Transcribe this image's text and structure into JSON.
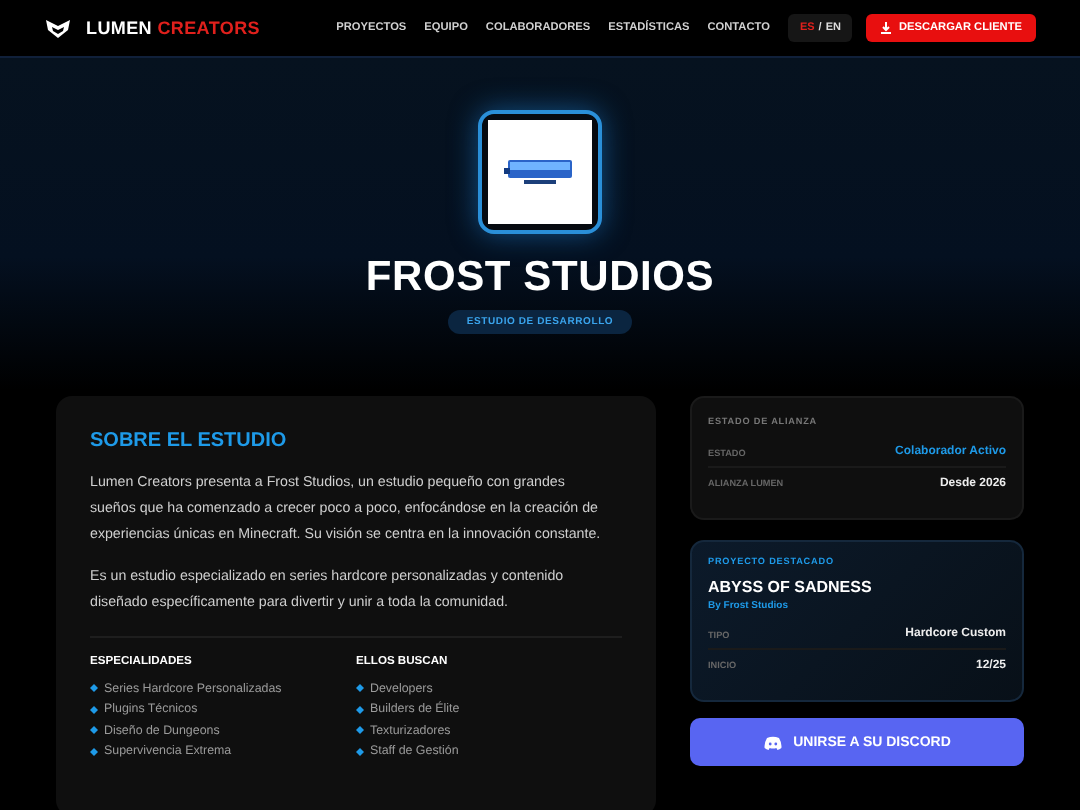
{
  "brand": {
    "name": "LUMEN",
    "accent": "CREATORS"
  },
  "nav": [
    "PROYECTOS",
    "EQUIPO",
    "COLABORADORES",
    "ESTADÍSTICAS",
    "CONTACTO"
  ],
  "languages": [
    {
      "label": "ES",
      "selected": true
    },
    {
      "label": "EN",
      "selected": false
    }
  ],
  "language_separator": "/",
  "download_button": "DESCARGAR CLIENTE",
  "hero": {
    "title": "FROST STUDIOS",
    "badge": "ESTUDIO DE DESARROLLO"
  },
  "about": {
    "heading": "SOBRE EL ESTUDIO",
    "paragraphs": [
      "Lumen Creators presenta a Frost Studios, un estudio pequeño con grandes sueños que ha comenzado a crecer poco a poco, enfocándose en la creación de experiencias únicas en Minecraft. Su visión se centra en la innovación constante.",
      "Es un estudio especializado en series hardcore personalizadas y contenido diseñado específicamente para divertir y unir a toda la comunidad."
    ],
    "lists": [
      {
        "heading": "ESPECIALIDADES",
        "items": [
          "Series Hardcore Personalizadas",
          "Plugins Técnicos",
          "Diseño de Dungeons",
          "Supervivencia Extrema"
        ]
      },
      {
        "heading": "ELLOS BUSCAN",
        "items": [
          "Developers",
          "Builders de Élite",
          "Texturizadores",
          "Staff de Gestión"
        ]
      }
    ]
  },
  "alliance": {
    "heading": "ESTADO DE ALIANZA",
    "rows": [
      {
        "label": "ESTADO",
        "value": "Colaborador Activo",
        "highlight": true
      },
      {
        "label": "ALIANZA LUMEN",
        "value": "Desde 2026",
        "highlight": false
      }
    ]
  },
  "project": {
    "kicker": "PROYECTO DESTACADO",
    "title": "ABYSS OF SADNESS",
    "by": "By Frost Studios",
    "rows": [
      {
        "label": "TIPO",
        "value": "Hardcore Custom"
      },
      {
        "label": "INICIO",
        "value": "12/25"
      }
    ]
  },
  "discord_button": "UNIRSE A SU DISCORD"
}
